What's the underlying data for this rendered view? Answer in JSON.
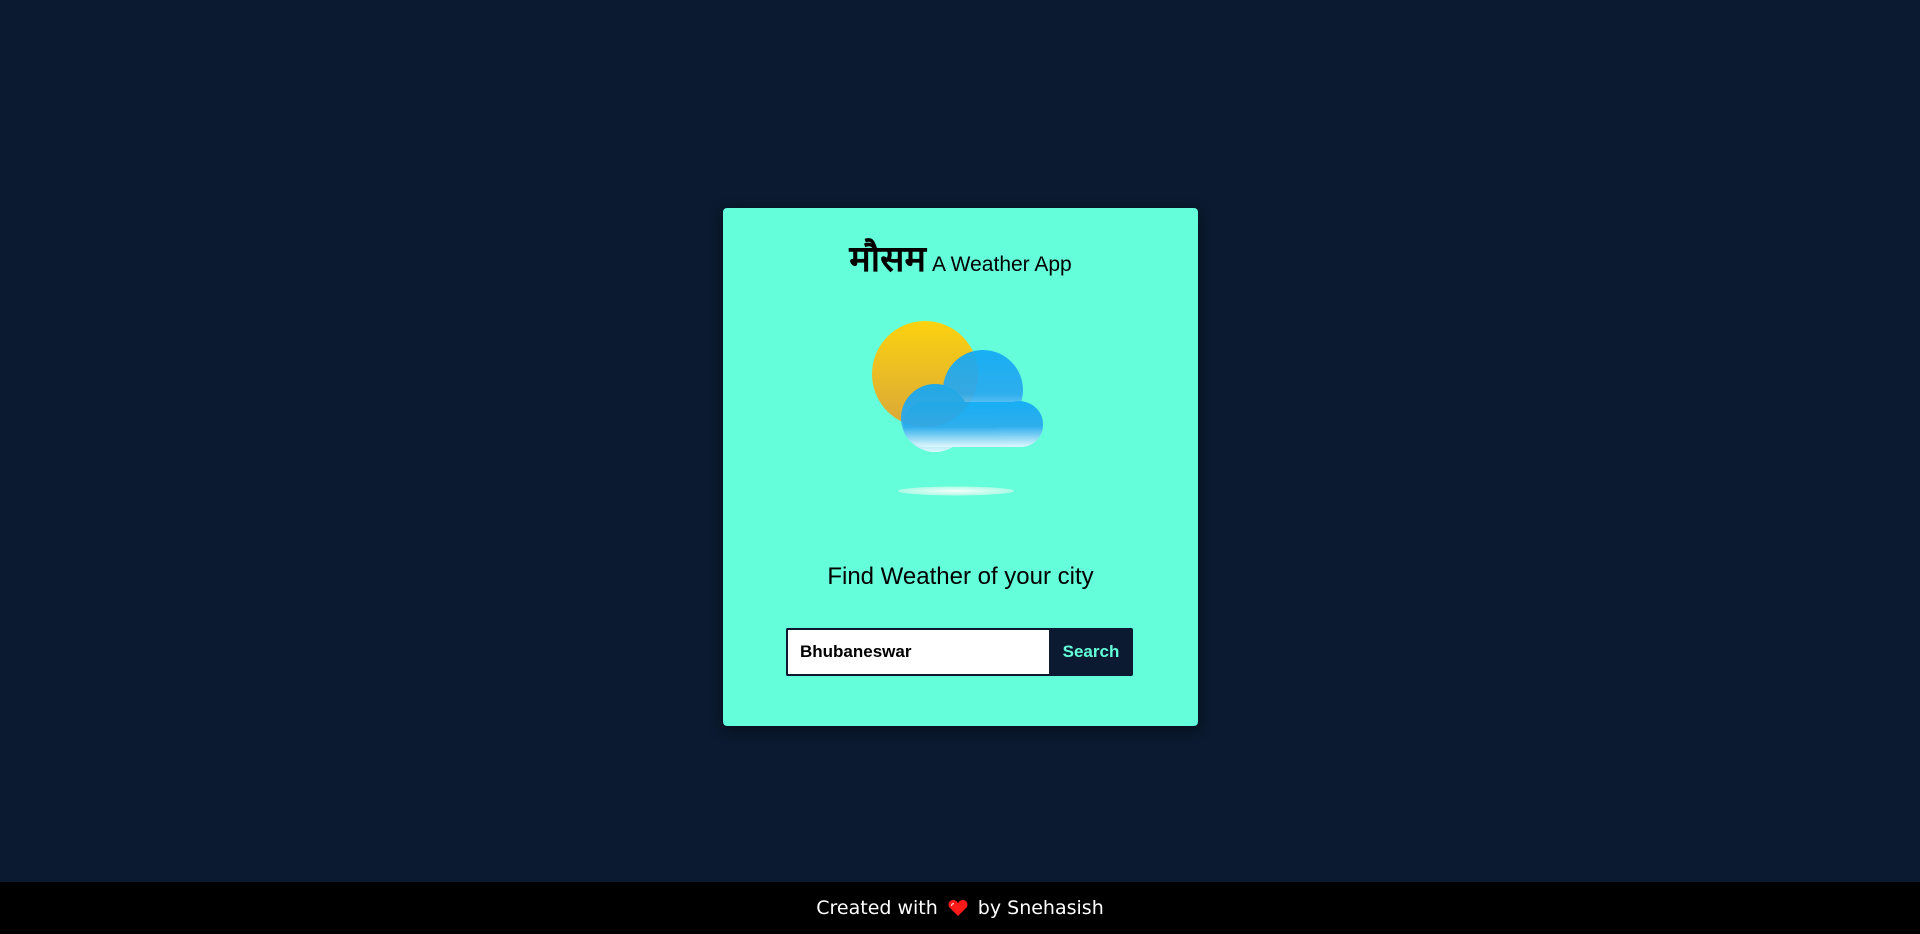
{
  "app": {
    "title_hindi": "मौसम",
    "title_sub": "A Weather App"
  },
  "illustration": {
    "icon": "partly-cloudy-icon"
  },
  "main": {
    "heading": "Find Weather of your city"
  },
  "search": {
    "value": "Bhubaneswar",
    "placeholder": "",
    "button_label": "Search"
  },
  "footer": {
    "prefix": "Created with",
    "heart_icon": "heart-icon",
    "suffix": "by Snehasish"
  },
  "colors": {
    "background": "#0b1a30",
    "card": "#64ffda",
    "accent_text": "#64ffda",
    "footer": "#000000",
    "heart": "#ff1a1a"
  }
}
